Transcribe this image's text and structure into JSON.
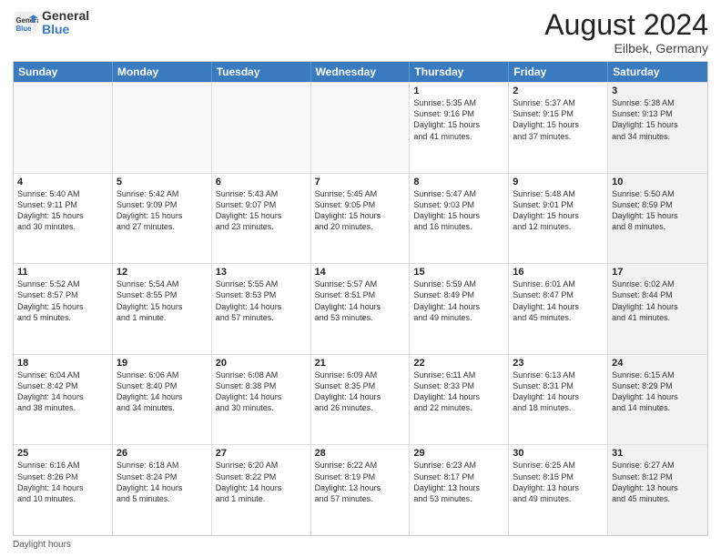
{
  "logo": {
    "general": "General",
    "blue": "Blue"
  },
  "title": {
    "month_year": "August 2024",
    "location": "Eilbek, Germany"
  },
  "calendar": {
    "headers": [
      "Sunday",
      "Monday",
      "Tuesday",
      "Wednesday",
      "Thursday",
      "Friday",
      "Saturday"
    ],
    "rows": [
      [
        {
          "day": "",
          "text": "",
          "empty": true
        },
        {
          "day": "",
          "text": "",
          "empty": true
        },
        {
          "day": "",
          "text": "",
          "empty": true
        },
        {
          "day": "",
          "text": "",
          "empty": true
        },
        {
          "day": "1",
          "text": "Sunrise: 5:35 AM\nSunset: 9:16 PM\nDaylight: 15 hours\nand 41 minutes.",
          "empty": false
        },
        {
          "day": "2",
          "text": "Sunrise: 5:37 AM\nSunset: 9:15 PM\nDaylight: 15 hours\nand 37 minutes.",
          "empty": false
        },
        {
          "day": "3",
          "text": "Sunrise: 5:38 AM\nSunset: 9:13 PM\nDaylight: 15 hours\nand 34 minutes.",
          "empty": false,
          "shaded": true
        }
      ],
      [
        {
          "day": "4",
          "text": "Sunrise: 5:40 AM\nSunset: 9:11 PM\nDaylight: 15 hours\nand 30 minutes.",
          "empty": false
        },
        {
          "day": "5",
          "text": "Sunrise: 5:42 AM\nSunset: 9:09 PM\nDaylight: 15 hours\nand 27 minutes.",
          "empty": false
        },
        {
          "day": "6",
          "text": "Sunrise: 5:43 AM\nSunset: 9:07 PM\nDaylight: 15 hours\nand 23 minutes.",
          "empty": false
        },
        {
          "day": "7",
          "text": "Sunrise: 5:45 AM\nSunset: 9:05 PM\nDaylight: 15 hours\nand 20 minutes.",
          "empty": false
        },
        {
          "day": "8",
          "text": "Sunrise: 5:47 AM\nSunset: 9:03 PM\nDaylight: 15 hours\nand 16 minutes.",
          "empty": false
        },
        {
          "day": "9",
          "text": "Sunrise: 5:48 AM\nSunset: 9:01 PM\nDaylight: 15 hours\nand 12 minutes.",
          "empty": false
        },
        {
          "day": "10",
          "text": "Sunrise: 5:50 AM\nSunset: 8:59 PM\nDaylight: 15 hours\nand 8 minutes.",
          "empty": false,
          "shaded": true
        }
      ],
      [
        {
          "day": "11",
          "text": "Sunrise: 5:52 AM\nSunset: 8:57 PM\nDaylight: 15 hours\nand 5 minutes.",
          "empty": false
        },
        {
          "day": "12",
          "text": "Sunrise: 5:54 AM\nSunset: 8:55 PM\nDaylight: 15 hours\nand 1 minute.",
          "empty": false
        },
        {
          "day": "13",
          "text": "Sunrise: 5:55 AM\nSunset: 8:53 PM\nDaylight: 14 hours\nand 57 minutes.",
          "empty": false
        },
        {
          "day": "14",
          "text": "Sunrise: 5:57 AM\nSunset: 8:51 PM\nDaylight: 14 hours\nand 53 minutes.",
          "empty": false
        },
        {
          "day": "15",
          "text": "Sunrise: 5:59 AM\nSunset: 8:49 PM\nDaylight: 14 hours\nand 49 minutes.",
          "empty": false
        },
        {
          "day": "16",
          "text": "Sunrise: 6:01 AM\nSunset: 8:47 PM\nDaylight: 14 hours\nand 45 minutes.",
          "empty": false
        },
        {
          "day": "17",
          "text": "Sunrise: 6:02 AM\nSunset: 8:44 PM\nDaylight: 14 hours\nand 41 minutes.",
          "empty": false,
          "shaded": true
        }
      ],
      [
        {
          "day": "18",
          "text": "Sunrise: 6:04 AM\nSunset: 8:42 PM\nDaylight: 14 hours\nand 38 minutes.",
          "empty": false
        },
        {
          "day": "19",
          "text": "Sunrise: 6:06 AM\nSunset: 8:40 PM\nDaylight: 14 hours\nand 34 minutes.",
          "empty": false
        },
        {
          "day": "20",
          "text": "Sunrise: 6:08 AM\nSunset: 8:38 PM\nDaylight: 14 hours\nand 30 minutes.",
          "empty": false
        },
        {
          "day": "21",
          "text": "Sunrise: 6:09 AM\nSunset: 8:35 PM\nDaylight: 14 hours\nand 26 minutes.",
          "empty": false
        },
        {
          "day": "22",
          "text": "Sunrise: 6:11 AM\nSunset: 8:33 PM\nDaylight: 14 hours\nand 22 minutes.",
          "empty": false
        },
        {
          "day": "23",
          "text": "Sunrise: 6:13 AM\nSunset: 8:31 PM\nDaylight: 14 hours\nand 18 minutes.",
          "empty": false
        },
        {
          "day": "24",
          "text": "Sunrise: 6:15 AM\nSunset: 8:29 PM\nDaylight: 14 hours\nand 14 minutes.",
          "empty": false,
          "shaded": true
        }
      ],
      [
        {
          "day": "25",
          "text": "Sunrise: 6:16 AM\nSunset: 8:26 PM\nDaylight: 14 hours\nand 10 minutes.",
          "empty": false
        },
        {
          "day": "26",
          "text": "Sunrise: 6:18 AM\nSunset: 8:24 PM\nDaylight: 14 hours\nand 5 minutes.",
          "empty": false
        },
        {
          "day": "27",
          "text": "Sunrise: 6:20 AM\nSunset: 8:22 PM\nDaylight: 14 hours\nand 1 minute.",
          "empty": false
        },
        {
          "day": "28",
          "text": "Sunrise: 6:22 AM\nSunset: 8:19 PM\nDaylight: 13 hours\nand 57 minutes.",
          "empty": false
        },
        {
          "day": "29",
          "text": "Sunrise: 6:23 AM\nSunset: 8:17 PM\nDaylight: 13 hours\nand 53 minutes.",
          "empty": false
        },
        {
          "day": "30",
          "text": "Sunrise: 6:25 AM\nSunset: 8:15 PM\nDaylight: 13 hours\nand 49 minutes.",
          "empty": false
        },
        {
          "day": "31",
          "text": "Sunrise: 6:27 AM\nSunset: 8:12 PM\nDaylight: 13 hours\nand 45 minutes.",
          "empty": false,
          "shaded": true
        }
      ]
    ]
  },
  "footer": {
    "note": "Daylight hours"
  }
}
